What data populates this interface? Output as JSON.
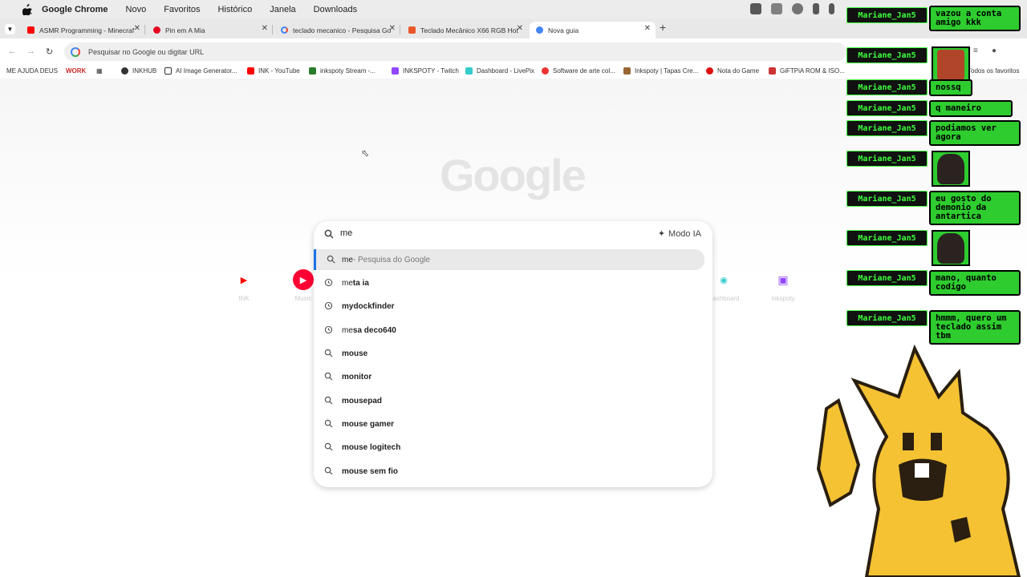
{
  "menubar": {
    "items": [
      "Google Chrome",
      "Novo",
      "Favoritos",
      "Histórico",
      "Janela",
      "Downloads"
    ]
  },
  "tabs": [
    {
      "title": "ASMR Programming - Minecraf",
      "color": "#ff0000"
    },
    {
      "title": "Pin em A Mia",
      "color": "#e60023"
    },
    {
      "title": "teclado mecanico - Pesquisa Go",
      "color": "#4285f4"
    },
    {
      "title": "Teclado Mecânico X66 RGB Hot",
      "color": "#e8572b"
    },
    {
      "title": "Nova guia",
      "color": "#4285f4"
    }
  ],
  "omnibox": {
    "placeholder": "Pesquisar no Google ou digitar URL"
  },
  "bookmarks": {
    "folders": [
      "ME AJUDA DEUS",
      "WORK"
    ],
    "items": [
      "INKHUB",
      "AI Image Generator...",
      "INK - YouTube",
      "inkspoty Stream -...",
      "INKSPOTY - Twitch",
      "Dashboard - LivePix",
      "Software de arte col...",
      "Inkspoty | Tapas Cre...",
      "Nota do Game",
      "GiFTPiA ROM & ISO..."
    ],
    "all_label": "Todos os favoritos"
  },
  "page": {
    "logo": "Google",
    "shortcuts": [
      "INK",
      "Music",
      "Dashboard",
      "inkspoty"
    ]
  },
  "search": {
    "value": "me",
    "ai_mode_label": "Modo IA",
    "suggestions": [
      {
        "prefix": "me",
        "rest": "",
        "suffix": " - Pesquisa do Google",
        "type": "search"
      },
      {
        "prefix": "me",
        "rest": "ta ia",
        "suffix": "",
        "type": "history"
      },
      {
        "prefix": "",
        "rest": "mydockfinder",
        "suffix": "",
        "type": "history"
      },
      {
        "prefix": "me",
        "rest": "sa deco640",
        "suffix": "",
        "type": "history"
      },
      {
        "prefix": "",
        "rest": "mouse",
        "suffix": "",
        "type": "search"
      },
      {
        "prefix": "",
        "rest": "monitor",
        "suffix": "",
        "type": "search"
      },
      {
        "prefix": "",
        "rest": "mousepad",
        "suffix": "",
        "type": "search"
      },
      {
        "prefix": "",
        "rest": "mouse gamer",
        "suffix": "",
        "type": "search"
      },
      {
        "prefix": "",
        "rest": "mouse logitech",
        "suffix": "",
        "type": "search"
      },
      {
        "prefix": "",
        "rest": "mouse sem fio",
        "suffix": "",
        "type": "search"
      }
    ]
  },
  "chat": {
    "user": "Mariane_Jan5",
    "messages": [
      {
        "text": "vazou a conta amigo kkk"
      },
      {
        "text": ""
      },
      {
        "text": "nossq"
      },
      {
        "text": "q maneiro"
      },
      {
        "text": "podiamos ver agora"
      },
      {
        "text": ""
      },
      {
        "text": "eu gosto do demonio da antartica"
      },
      {
        "text": ""
      },
      {
        "text": "mano, quanto codigo"
      },
      {
        "text": "hmmm, quero um teclado assim tbm"
      }
    ]
  }
}
